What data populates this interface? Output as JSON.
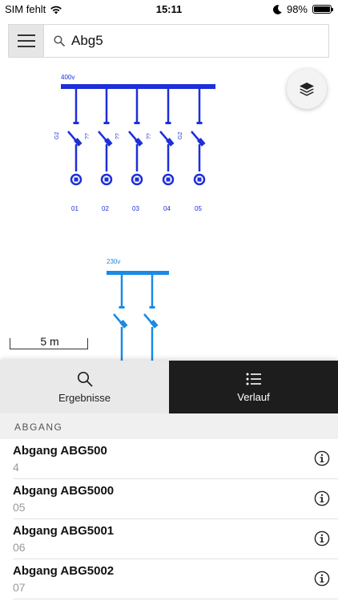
{
  "status_bar": {
    "carrier": "SIM fehlt",
    "time": "15:11",
    "battery": "98%",
    "battery_level": 0.98,
    "icons": [
      "wifi-icon",
      "moon-icon",
      "battery-icon"
    ]
  },
  "search": {
    "value": "Abg5",
    "icon": "search-icon",
    "menu_icon": "hamburger-menu-icon"
  },
  "map": {
    "layers_icon": "layers-icon",
    "scale_label": "5 m",
    "diagram_blue": "#1d2fd9",
    "diagram_lightblue": "#1a8ae6",
    "panel1": {
      "voltage": "400v",
      "fuse_labels": [
        "G2",
        "??",
        "??",
        "??",
        "G2"
      ],
      "outputs": [
        "01",
        "02",
        "03",
        "04",
        "05"
      ]
    },
    "panel2": {
      "voltage": "230v"
    }
  },
  "tabs": [
    {
      "label": "Ergebnisse",
      "icon": "search-icon",
      "active": false
    },
    {
      "label": "Verlauf",
      "icon": "list-icon",
      "active": true
    }
  ],
  "results": {
    "section_title": "ABGANG",
    "items": [
      {
        "title": "Abgang ABG500",
        "subtitle": "4",
        "icon": "info-icon"
      },
      {
        "title": "Abgang ABG5000",
        "subtitle": "05",
        "icon": "info-icon"
      },
      {
        "title": "Abgang ABG5001",
        "subtitle": "06",
        "icon": "info-icon"
      },
      {
        "title": "Abgang ABG5002",
        "subtitle": "07",
        "icon": "info-icon"
      }
    ]
  }
}
